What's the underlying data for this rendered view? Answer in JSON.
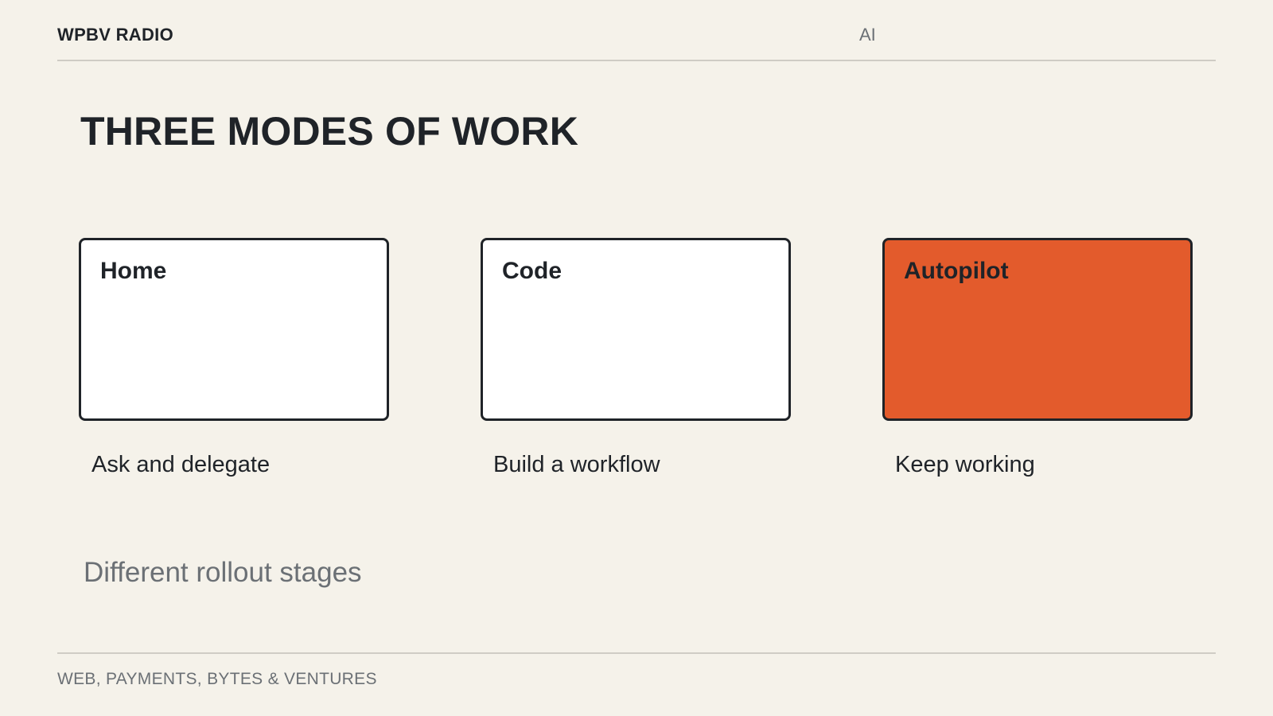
{
  "header": {
    "brand": "WPBV RADIO",
    "section": "AI"
  },
  "slide": {
    "title": "THREE MODES OF WORK",
    "modes": [
      {
        "label": "Home",
        "caption": "Ask and delegate",
        "highlighted": false
      },
      {
        "label": "Code",
        "caption": "Build a workflow",
        "highlighted": false
      },
      {
        "label": "Autopilot",
        "caption": "Keep working",
        "highlighted": true
      }
    ],
    "subtitle": "Different rollout stages"
  },
  "footer": {
    "text": "WEB, PAYMENTS, BYTES & VENTURES"
  },
  "colors": {
    "background": "#f5f2ea",
    "accent": "#e35b2c",
    "text": "#1f2328",
    "muted": "#6b7075"
  }
}
